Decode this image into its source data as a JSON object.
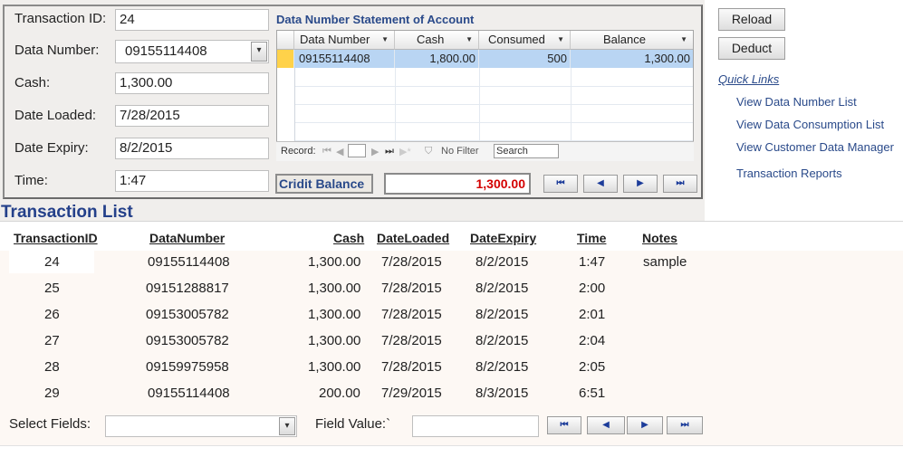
{
  "form": {
    "transaction_id_label": "Transaction ID:",
    "transaction_id_value": "24",
    "data_number_label": "Data Number:",
    "data_number_value": "09155114408",
    "cash_label": "Cash:",
    "cash_value": "1,300.00",
    "date_loaded_label": "Date Loaded:",
    "date_loaded_value": "7/28/2015",
    "date_expiry_label": "Date Expiry:",
    "date_expiry_value": "8/2/2015",
    "time_label": "Time:",
    "time_value": "1:47"
  },
  "statement": {
    "title": "Data Number Statement of Account",
    "columns": [
      "Data Number",
      "Cash",
      "Consumed",
      "Balance"
    ],
    "rows": [
      {
        "data_number": "09155114408",
        "cash": "1,800.00",
        "consumed": "500",
        "balance": "1,300.00"
      }
    ],
    "nav": {
      "record_label": "Record:",
      "no_filter": "No Filter",
      "search": "Search"
    }
  },
  "credit": {
    "label": "Cridit Balance",
    "value": "1,300.00"
  },
  "nav_buttons": {
    "first": "⏮",
    "prev": "◀",
    "next": "▶",
    "last": "⏭"
  },
  "actions": {
    "reload": "Reload",
    "deduct": "Deduct"
  },
  "quick_links": {
    "title": "Quick Links",
    "items": [
      "View Data Number List",
      "View Data Consumption List",
      "View Customer Data Manager",
      "Transaction Reports"
    ]
  },
  "transaction_list": {
    "title": "Transaction List",
    "headers": [
      "TransactionID",
      "DataNumber",
      "Cash",
      "DateLoaded",
      "DateExpiry",
      "Time",
      "Notes"
    ],
    "rows": [
      {
        "id": "24",
        "number": "09155114408",
        "cash": "1,300.00",
        "loaded": "7/28/2015",
        "expiry": "8/2/2015",
        "time": "1:47",
        "notes": "sample"
      },
      {
        "id": "25",
        "number": "09151288817",
        "cash": "1,300.00",
        "loaded": "7/28/2015",
        "expiry": "8/2/2015",
        "time": "2:00",
        "notes": ""
      },
      {
        "id": "26",
        "number": "09153005782",
        "cash": "1,300.00",
        "loaded": "7/28/2015",
        "expiry": "8/2/2015",
        "time": "2:01",
        "notes": ""
      },
      {
        "id": "27",
        "number": "09153005782",
        "cash": "1,300.00",
        "loaded": "7/28/2015",
        "expiry": "8/2/2015",
        "time": "2:04",
        "notes": ""
      },
      {
        "id": "28",
        "number": "09159975958",
        "cash": "1,300.00",
        "loaded": "7/28/2015",
        "expiry": "8/2/2015",
        "time": "2:05",
        "notes": ""
      },
      {
        "id": "29",
        "number": "09155114408",
        "cash": "200.00",
        "loaded": "7/29/2015",
        "expiry": "8/3/2015",
        "time": "6:51",
        "notes": ""
      }
    ]
  },
  "filter": {
    "select_fields_label": "Select Fields:",
    "select_fields_value": "",
    "field_value_label": "Field Value:`",
    "field_value_value": ""
  },
  "colors": {
    "accent": "#24408a",
    "credit": "#d40000",
    "selection": "#b9d5f3"
  }
}
